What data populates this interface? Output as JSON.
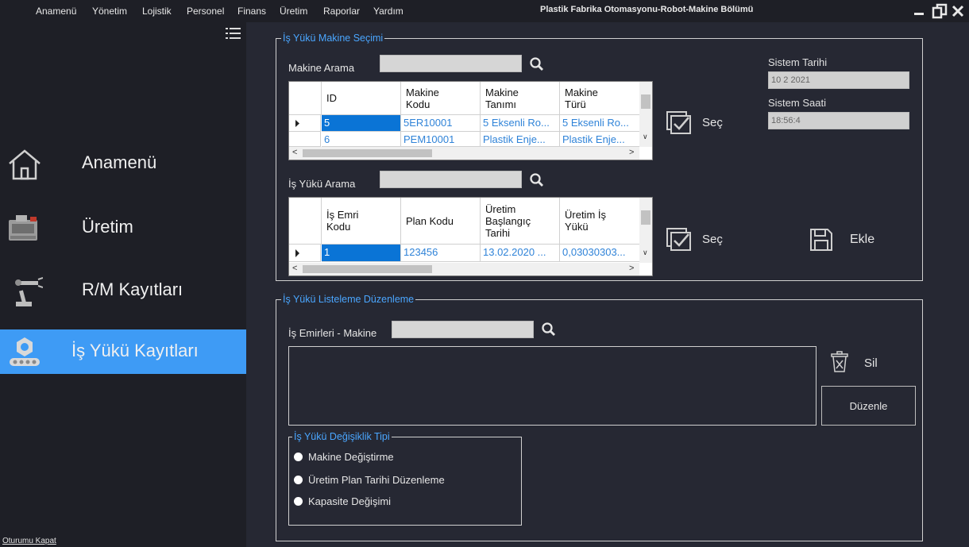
{
  "menubar": {
    "items": [
      "Anamenü",
      "Yönetim",
      "Lojistik",
      "Personel",
      "Finans",
      "Üretim",
      "Raporlar",
      "Yardım"
    ],
    "title": "Plastik Fabrika Otomasyonu-Robot-Makine Bölümü"
  },
  "sidebar": {
    "items": [
      {
        "label": "Anamenü",
        "icon": "home-icon"
      },
      {
        "label": "Üretim",
        "icon": "factory-machine-icon"
      },
      {
        "label": "R/M Kayıtları",
        "icon": "robot-arm-icon"
      },
      {
        "label": "İş Yükü Kayıtları",
        "icon": "conveyor-gear-icon",
        "active": true
      }
    ],
    "logout": "Oturumu Kapat"
  },
  "machine_select": {
    "legend": "İş Yükü Makine Seçimi",
    "search_label": "Makine Arama",
    "search_value": "",
    "columns": [
      "ID",
      "Makine\nKodu",
      "Makine\nTanımı",
      "Makine\nTürü"
    ],
    "rows": [
      [
        "5",
        "5ER10001",
        "5 Eksenli Ro...",
        "5 Eksenli Ro..."
      ],
      [
        "6",
        "PEM10001",
        "Plastik Enje...",
        "Plastik Enje..."
      ]
    ],
    "select_label": "Seç"
  },
  "system": {
    "date_label": "Sistem Tarihi",
    "date_value": "10 2 2021",
    "time_label": "Sistem Saati",
    "time_value": "18:56:4"
  },
  "workload_select": {
    "search_label": "İş Yükü Arama",
    "search_value": "",
    "columns": [
      "İş Emri\nKodu",
      "Plan Kodu",
      "Üretim\nBaşlangıç\nTarihi",
      "Üretim İş\nYükü"
    ],
    "rows": [
      [
        "1",
        "123456",
        "13.02.2020 ...",
        "0,03030303..."
      ]
    ],
    "select_label": "Seç",
    "add_label": "Ekle"
  },
  "listing": {
    "legend": "İş Yükü Listeleme Düzenleme",
    "search_label": "İş Emirleri - Makine",
    "search_value": "",
    "delete_label": "Sil",
    "edit_label": "Düzenle",
    "change_type": {
      "legend": "İş Yükü Değişiklik Tipi",
      "options": [
        "Makine Değiştirme",
        "Üretim Plan Tarihi Düzenleme",
        "Kapasite Değişimi"
      ]
    }
  },
  "colors": {
    "background": "#262833",
    "sidebar": "#1e1f26",
    "accent": "#3e9bf5",
    "legend": "#4aa6ff",
    "selection": "#0a74d6"
  }
}
